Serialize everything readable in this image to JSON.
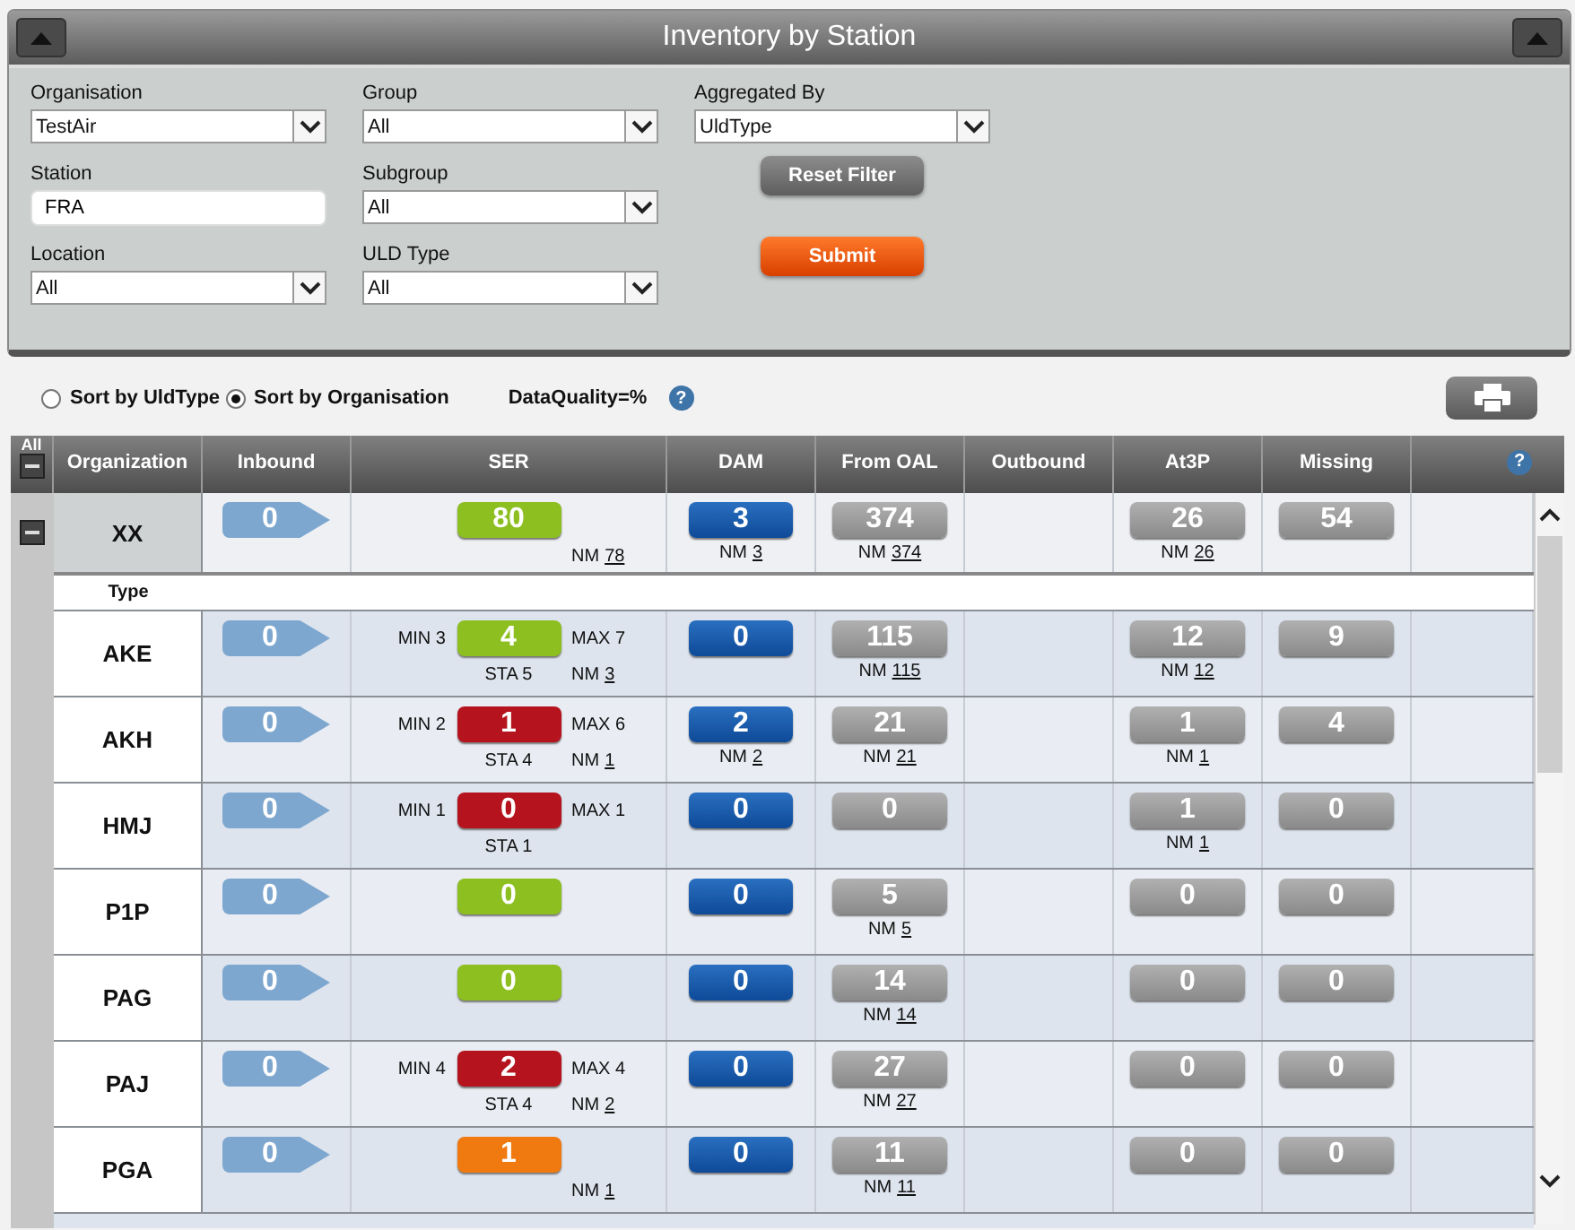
{
  "window": {
    "title": "Inventory by Station"
  },
  "filter_columns": [
    [
      {
        "label": "Organisation",
        "kind": "select",
        "value": "TestAir"
      },
      {
        "label": "Station",
        "kind": "text",
        "value": "FRA"
      },
      {
        "label": "Location",
        "kind": "select",
        "value": "All"
      }
    ],
    [
      {
        "label": "Group",
        "kind": "select",
        "value": "All"
      },
      {
        "label": "Subgroup",
        "kind": "select",
        "value": "All"
      },
      {
        "label": "ULD Type",
        "kind": "select",
        "value": "All"
      }
    ],
    [
      {
        "label": "Aggregated By",
        "kind": "select",
        "value": "UldType"
      }
    ]
  ],
  "buttons": [
    {
      "label": "Reset Filter",
      "kind": "reset"
    },
    {
      "label": "Submit",
      "kind": "submit"
    }
  ],
  "sort_options": [
    {
      "label": "Sort by UldType",
      "selected": false
    },
    {
      "label": "Sort by Organisation",
      "selected": true
    }
  ],
  "data_quality": "DataQuality=%",
  "data_quality_help": "?",
  "table": {
    "all_label": "All",
    "all_expanded": true,
    "columns": [
      {
        "kind": "org",
        "label": "Organization"
      },
      {
        "kind": "inbound",
        "label": "Inbound"
      },
      {
        "kind": "ser",
        "label": "SER"
      },
      {
        "kind": "dam",
        "label": "DAM"
      },
      {
        "kind": "from_oal",
        "label": "From OAL"
      },
      {
        "kind": "outbound",
        "label": "Outbound"
      },
      {
        "kind": "at3p",
        "label": "At3P"
      },
      {
        "kind": "missing",
        "label": "Missing"
      },
      {
        "kind": "help",
        "label": "?"
      }
    ],
    "summary": {
      "org": "XX",
      "expanded": true,
      "inbound": {
        "value": "0"
      },
      "ser": {
        "value": "80",
        "color": "#8cbf1f",
        "nm": {
          "label": "NM",
          "value": "78"
        }
      },
      "dam": {
        "value": "3",
        "nm": {
          "label": "NM",
          "value": "3"
        }
      },
      "from_oal": {
        "value": "374",
        "nm": {
          "label": "NM",
          "value": "374"
        }
      },
      "at3p": {
        "value": "26",
        "nm": {
          "label": "NM",
          "value": "26"
        }
      },
      "missing": {
        "value": "54"
      }
    },
    "subheader": "Type",
    "rows": [
      {
        "org": "AKE",
        "inbound": {
          "value": "0"
        },
        "ser": {
          "value": "4",
          "color": "#8cbf1f",
          "min": "MIN 3",
          "max": "MAX 7",
          "sta": "STA 5",
          "nm": {
            "label": "NM",
            "value": "3"
          }
        },
        "dam": {
          "value": "0"
        },
        "from_oal": {
          "value": "115",
          "nm": {
            "label": "NM",
            "value": "115"
          }
        },
        "at3p": {
          "value": "12",
          "nm": {
            "label": "NM",
            "value": "12"
          }
        },
        "missing": {
          "value": "9"
        }
      },
      {
        "org": "AKH",
        "inbound": {
          "value": "0"
        },
        "ser": {
          "value": "1",
          "color": "#b5141f",
          "min": "MIN 2",
          "max": "MAX 6",
          "sta": "STA 4",
          "nm": {
            "label": "NM",
            "value": "1"
          }
        },
        "dam": {
          "value": "2",
          "nm": {
            "label": "NM",
            "value": "2"
          }
        },
        "from_oal": {
          "value": "21",
          "nm": {
            "label": "NM",
            "value": "21"
          }
        },
        "at3p": {
          "value": "1",
          "nm": {
            "label": "NM",
            "value": "1"
          }
        },
        "missing": {
          "value": "4"
        }
      },
      {
        "org": "HMJ",
        "inbound": {
          "value": "0"
        },
        "ser": {
          "value": "0",
          "color": "#b5141f",
          "min": "MIN 1",
          "max": "MAX 1",
          "sta": "STA 1"
        },
        "dam": {
          "value": "0"
        },
        "from_oal": {
          "value": "0"
        },
        "at3p": {
          "value": "1",
          "nm": {
            "label": "NM",
            "value": "1"
          }
        },
        "missing": {
          "value": "0"
        }
      },
      {
        "org": "P1P",
        "inbound": {
          "value": "0"
        },
        "ser": {
          "value": "0",
          "color": "#8cbf1f"
        },
        "dam": {
          "value": "0"
        },
        "from_oal": {
          "value": "5",
          "nm": {
            "label": "NM",
            "value": "5"
          }
        },
        "at3p": {
          "value": "0"
        },
        "missing": {
          "value": "0"
        }
      },
      {
        "org": "PAG",
        "inbound": {
          "value": "0"
        },
        "ser": {
          "value": "0",
          "color": "#8cbf1f"
        },
        "dam": {
          "value": "0"
        },
        "from_oal": {
          "value": "14",
          "nm": {
            "label": "NM",
            "value": "14"
          }
        },
        "at3p": {
          "value": "0"
        },
        "missing": {
          "value": "0"
        }
      },
      {
        "org": "PAJ",
        "inbound": {
          "value": "0"
        },
        "ser": {
          "value": "2",
          "color": "#b5141f",
          "min": "MIN 4",
          "max": "MAX 4",
          "sta": "STA 4",
          "nm": {
            "label": "NM",
            "value": "2"
          }
        },
        "dam": {
          "value": "0"
        },
        "from_oal": {
          "value": "27",
          "nm": {
            "label": "NM",
            "value": "27"
          }
        },
        "at3p": {
          "value": "0"
        },
        "missing": {
          "value": "0"
        }
      },
      {
        "org": "PGA",
        "inbound": {
          "value": "0"
        },
        "ser": {
          "value": "1",
          "color": "#f07a10",
          "nm": {
            "label": "NM",
            "value": "1"
          }
        },
        "dam": {
          "value": "0"
        },
        "from_oal": {
          "value": "11",
          "nm": {
            "label": "NM",
            "value": "11"
          }
        },
        "at3p": {
          "value": "0"
        },
        "missing": {
          "value": "0"
        }
      }
    ]
  }
}
